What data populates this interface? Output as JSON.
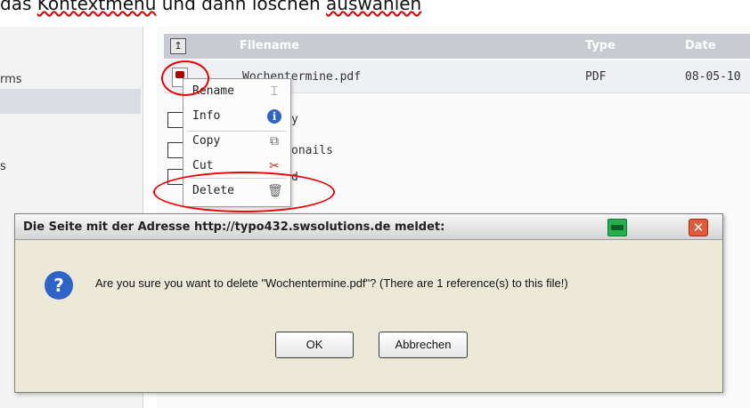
{
  "top_note": {
    "prefix": "das ",
    "squiggle1": "Kontextmenü",
    "middle": " und dann löschen ",
    "squiggle2": "auswählen"
  },
  "sidebar": {
    "items": [
      {
        "label": "rms"
      },
      {
        "label": "s"
      }
    ]
  },
  "file_table": {
    "columns": [
      "Filename",
      "Type",
      "Date"
    ],
    "row": {
      "filename": "Wochentermine.pdf",
      "type": "PDF",
      "date": "08-05-10"
    },
    "background_fragments": [
      "y",
      "onails",
      "d"
    ]
  },
  "context_menu": {
    "items": [
      {
        "label": "Rename",
        "icon": "rename-icon"
      },
      {
        "label": "Info",
        "icon": "info-icon"
      },
      {
        "label": "Copy",
        "icon": "copy-icon"
      },
      {
        "label": "Cut",
        "icon": "cut-icon"
      },
      {
        "label": "Delete",
        "icon": "trash-icon"
      }
    ]
  },
  "dialog": {
    "title": "Die Seite mit der Adresse http://typo432.swsolutions.de meldet:",
    "message": "Are you sure you want to delete \"Wochentermine.pdf\"? (There are 1 reference(s) to this file!)",
    "ok_label": "OK",
    "cancel_label": "Abbrechen"
  },
  "colors": {
    "annotation": "#e00000",
    "dialog_bg": "#ece9d8",
    "header_bg": "#c8cbd0"
  }
}
